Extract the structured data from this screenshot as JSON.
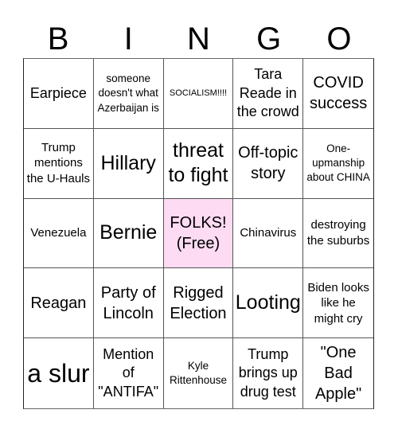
{
  "header": {
    "letters": [
      "B",
      "I",
      "N",
      "G",
      "O"
    ]
  },
  "free_cell_color": "#fddbf3",
  "cells": [
    {
      "text": "Earpiece",
      "size": "lg"
    },
    {
      "text": "someone doesn't what Azerbaijan is",
      "size": "sm"
    },
    {
      "text": "SOCIALISM!!!!",
      "size": "xs"
    },
    {
      "text": "Tara Reade in the crowd",
      "size": "lg"
    },
    {
      "text": "COVID success",
      "size": "xl"
    },
    {
      "text": "Trump mentions the U-Hauls",
      "size": "md"
    },
    {
      "text": "Hillary",
      "size": "xxl"
    },
    {
      "text": "threat to fight",
      "size": "xxl"
    },
    {
      "text": "Off-topic story",
      "size": "xl"
    },
    {
      "text": "One-upmanship about CHINA",
      "size": "sm"
    },
    {
      "text": "Venezuela",
      "size": "md"
    },
    {
      "text": "Bernie",
      "size": "xxl"
    },
    {
      "text": "FOLKS! (Free)",
      "size": "xl",
      "free": true
    },
    {
      "text": "Chinavirus",
      "size": "md"
    },
    {
      "text": "destroying the suburbs",
      "size": "md"
    },
    {
      "text": "Reagan",
      "size": "xl"
    },
    {
      "text": "Party of Lincoln",
      "size": "xl"
    },
    {
      "text": "Rigged Election",
      "size": "xl"
    },
    {
      "text": "Looting",
      "size": "xxl"
    },
    {
      "text": "Biden looks like he might cry",
      "size": "md"
    },
    {
      "text": "a slur",
      "size": "huge"
    },
    {
      "text": "Mention of \"ANTIFA\"",
      "size": "lg"
    },
    {
      "text": "Kyle Rittenhouse",
      "size": "sm"
    },
    {
      "text": "Trump brings up drug test",
      "size": "lg"
    },
    {
      "text": "\"One Bad Apple\"",
      "size": "xl"
    }
  ]
}
